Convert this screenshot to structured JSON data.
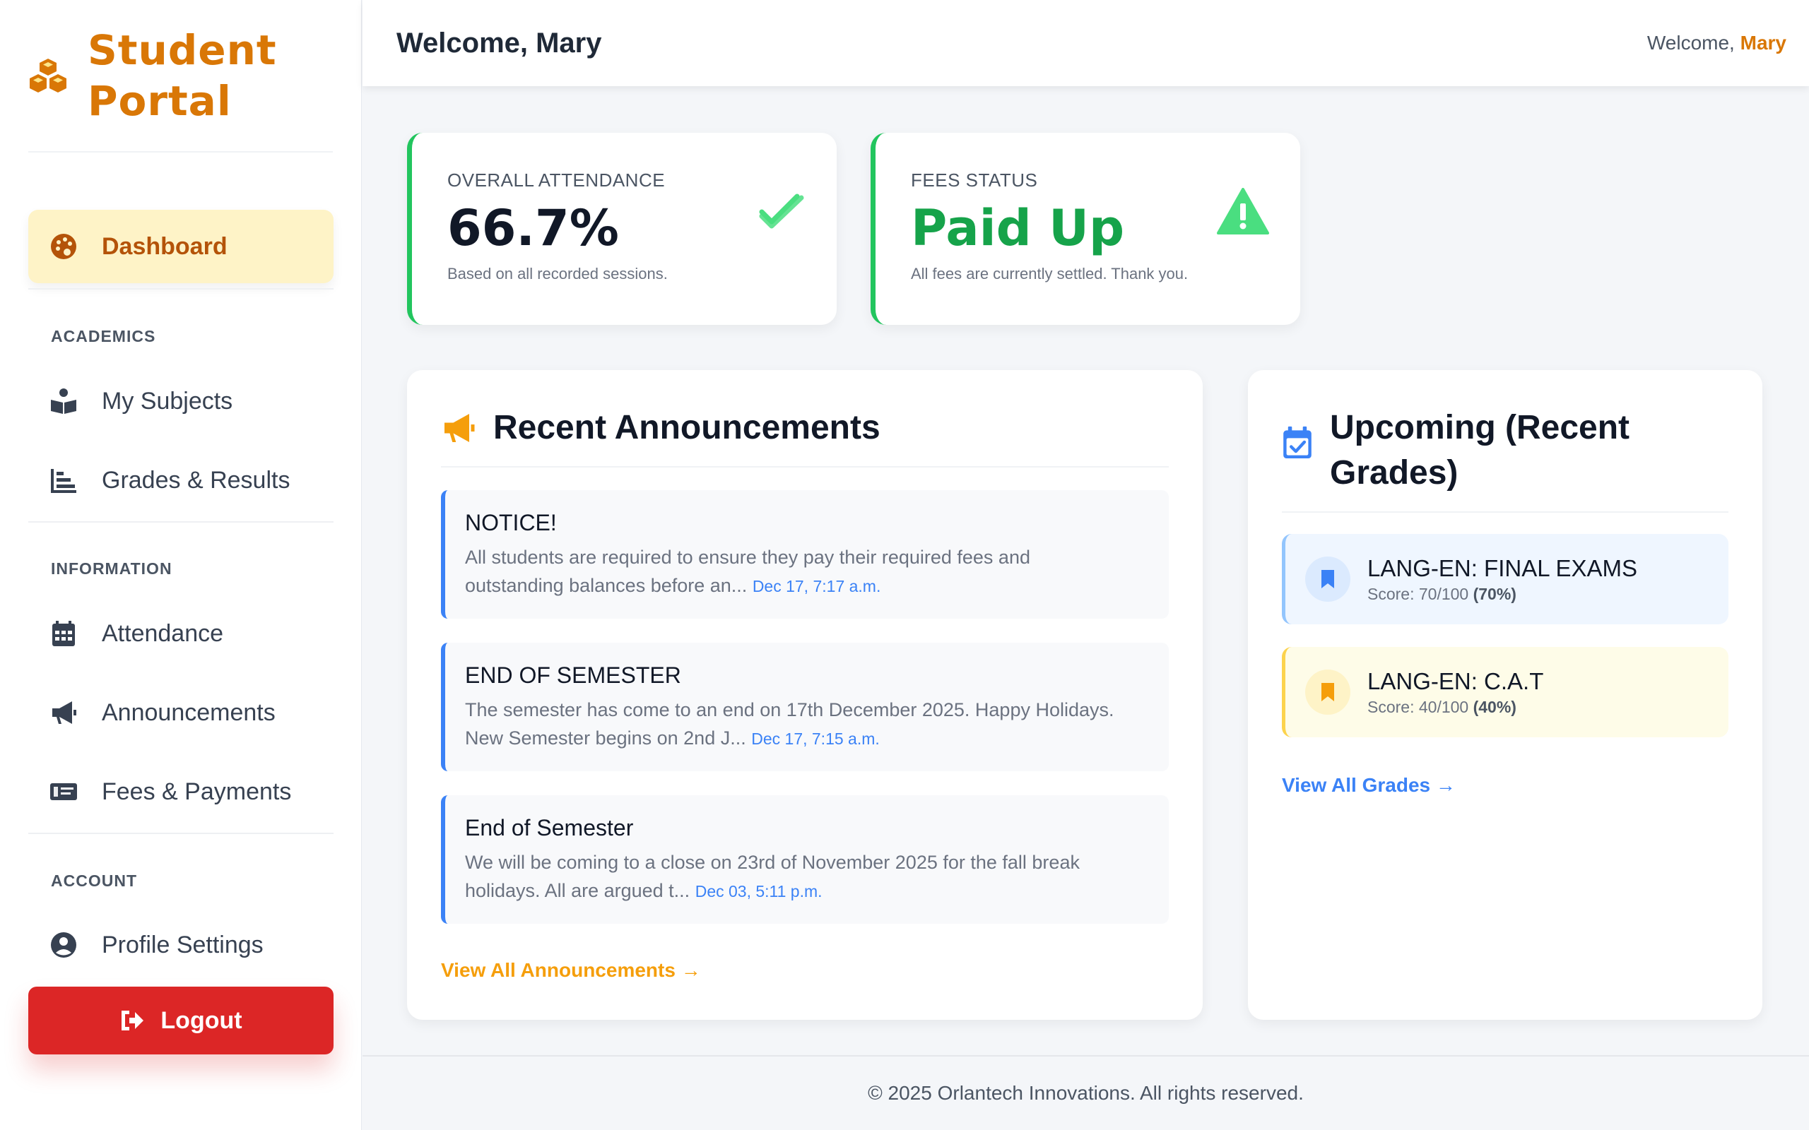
{
  "brand": {
    "name_line1": "Student",
    "name_line2": "Portal",
    "icon": "cubes-icon"
  },
  "colors": {
    "accent": "#d97706",
    "success": "#16a34a",
    "danger": "#dc2626",
    "link": "#3b82f6"
  },
  "sidebar": {
    "active": {
      "label": "Dashboard",
      "icon": "palette-icon"
    },
    "sections": [
      {
        "label": "ACADEMICS",
        "items": [
          {
            "label": "My Subjects",
            "icon": "book-reader-icon"
          },
          {
            "label": "Grades & Results",
            "icon": "chart-bar-icon"
          }
        ]
      },
      {
        "label": "INFORMATION",
        "items": [
          {
            "label": "Attendance",
            "icon": "calendar-icon"
          },
          {
            "label": "Announcements",
            "icon": "megaphone-icon"
          },
          {
            "label": "Fees & Payments",
            "icon": "money-bill-icon"
          }
        ]
      },
      {
        "label": "ACCOUNT",
        "items": [
          {
            "label": "Profile Settings",
            "icon": "user-circle-icon"
          }
        ]
      }
    ],
    "logout_label": "Logout"
  },
  "header": {
    "title": "Welcome, Mary",
    "welcome_prefix": "Welcome,",
    "user_name": "Mary"
  },
  "stats": {
    "attendance": {
      "label": "OVERALL ATTENDANCE",
      "value": "66.7%",
      "sub": "Based on all recorded sessions.",
      "icon": "check-double-icon"
    },
    "fees": {
      "label": "FEES STATUS",
      "value": "Paid Up",
      "sub": "All fees are currently settled. Thank you.",
      "icon": "warning-triangle-icon"
    }
  },
  "announcements": {
    "title": "Recent Announcements",
    "items": [
      {
        "title": "NOTICE!",
        "line1": "All students are required to ensure they pay their required fees and",
        "line2": "outstanding balances before an...",
        "date": "Dec 17, 7:17 a.m."
      },
      {
        "title": "END OF SEMESTER",
        "line1": "The semester has come to an end on 17th December 2025. Happy Holidays.",
        "line2": "New Semester begins on 2nd J...",
        "date": "Dec 17, 7:15 a.m."
      },
      {
        "title": "End of Semester",
        "line1": "We will be coming to a close on 23rd of November 2025 for the fall break",
        "line2": "holidays. All are argued t...",
        "date": "Dec 03, 5:11 p.m."
      }
    ],
    "view_all": "View All Announcements →"
  },
  "grades": {
    "title_line1": "Upcoming (Recent",
    "title_line2": "Grades)",
    "items": [
      {
        "title": "LANG-EN: FINAL EXAMS",
        "score_prefix": "Score: 70/100",
        "percent": "(70%)"
      },
      {
        "title": "LANG-EN: C.A.T",
        "score_prefix": "Score: 40/100",
        "percent": "(40%)"
      }
    ],
    "view_all": "View All Grades →"
  },
  "footer": {
    "text": "© 2025 Orlantech Innovations. All rights reserved."
  }
}
